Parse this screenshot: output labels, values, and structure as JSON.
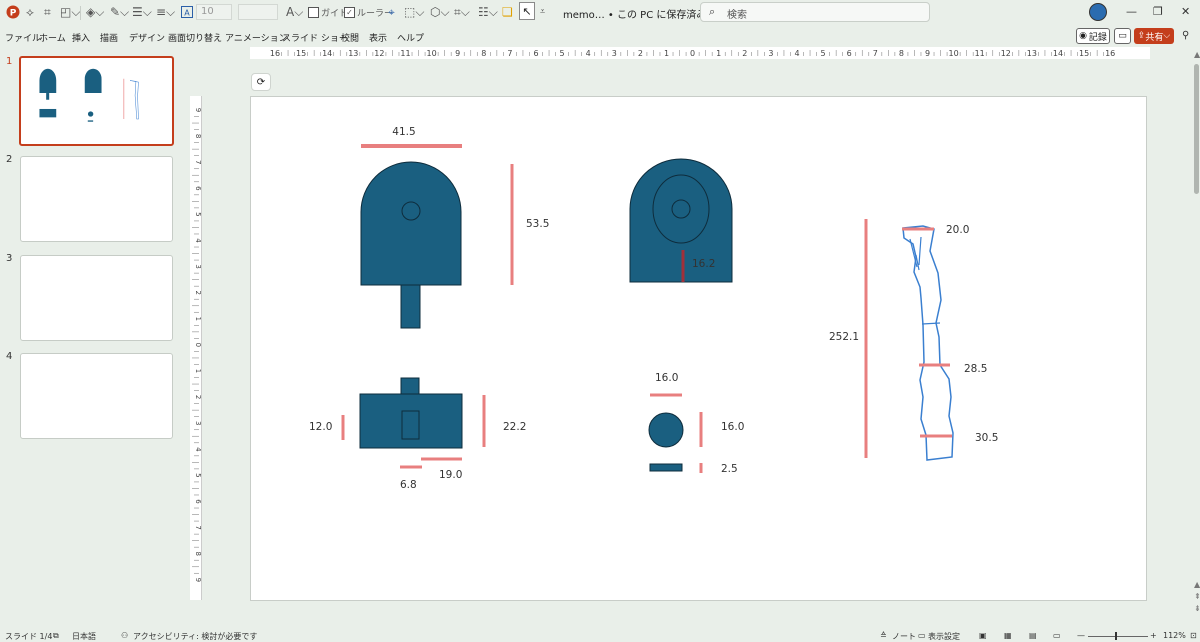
{
  "titlebar": {
    "font_size_value": "10",
    "guide_label": "ガイド",
    "ruler_label": "ルーラー",
    "doc_title": "memo… • この PC に保存済み ⌵",
    "search_placeholder": "検索",
    "window_controls": [
      "—",
      "❐",
      "✕"
    ]
  },
  "menubar": {
    "items": [
      "ファイル",
      "ホーム",
      "挿入",
      "描画",
      "デザイン",
      "画面切り替え",
      "アニメーション",
      "スライド ショー",
      "校閲",
      "表示",
      "ヘルプ"
    ],
    "record_label": "記録",
    "share_label": "共有"
  },
  "slides_panel": {
    "numbers": [
      "1",
      "2",
      "3",
      "4"
    ]
  },
  "ruler": {
    "h_labels": [
      "16",
      "15",
      "14",
      "13",
      "12",
      "11",
      "10",
      "9",
      "8",
      "7",
      "6",
      "5",
      "4",
      "3",
      "2",
      "1",
      "0",
      "1",
      "2",
      "3",
      "4",
      "5",
      "6",
      "7",
      "8",
      "9",
      "10",
      "11",
      "12",
      "13",
      "14",
      "15",
      "16"
    ],
    "v_labels": [
      "9",
      "8",
      "7",
      "6",
      "5",
      "4",
      "3",
      "2",
      "1",
      "0",
      "1",
      "2",
      "3",
      "4",
      "5",
      "6",
      "7",
      "8",
      "9"
    ]
  },
  "slide": {
    "dims": {
      "top_width": "41.5",
      "side_height": "53.5",
      "front_inner": "16.2",
      "total_length": "252.1",
      "tip_width": "20.0",
      "mid_width": "28.5",
      "base_width": "30.5",
      "base_height": "12.0",
      "base_depth": "22.2",
      "slot_width": "6.8",
      "base_length": "19.0",
      "circle_top": "16.0",
      "circle_side": "16.0",
      "disc_thickness": "2.5"
    },
    "colors": {
      "shape_fill": "#1a5f80",
      "dim_line": "#e87f7f",
      "dark_line": "#a0303a",
      "sketch": "#3a7fd0"
    }
  },
  "statusbar": {
    "slide_indicator": "スライド 1/4",
    "language": "日本語",
    "accessibility": "アクセシビリティ: 検討が必要です",
    "notes": "ノート",
    "display_settings": "表示設定",
    "zoom": "112%"
  }
}
